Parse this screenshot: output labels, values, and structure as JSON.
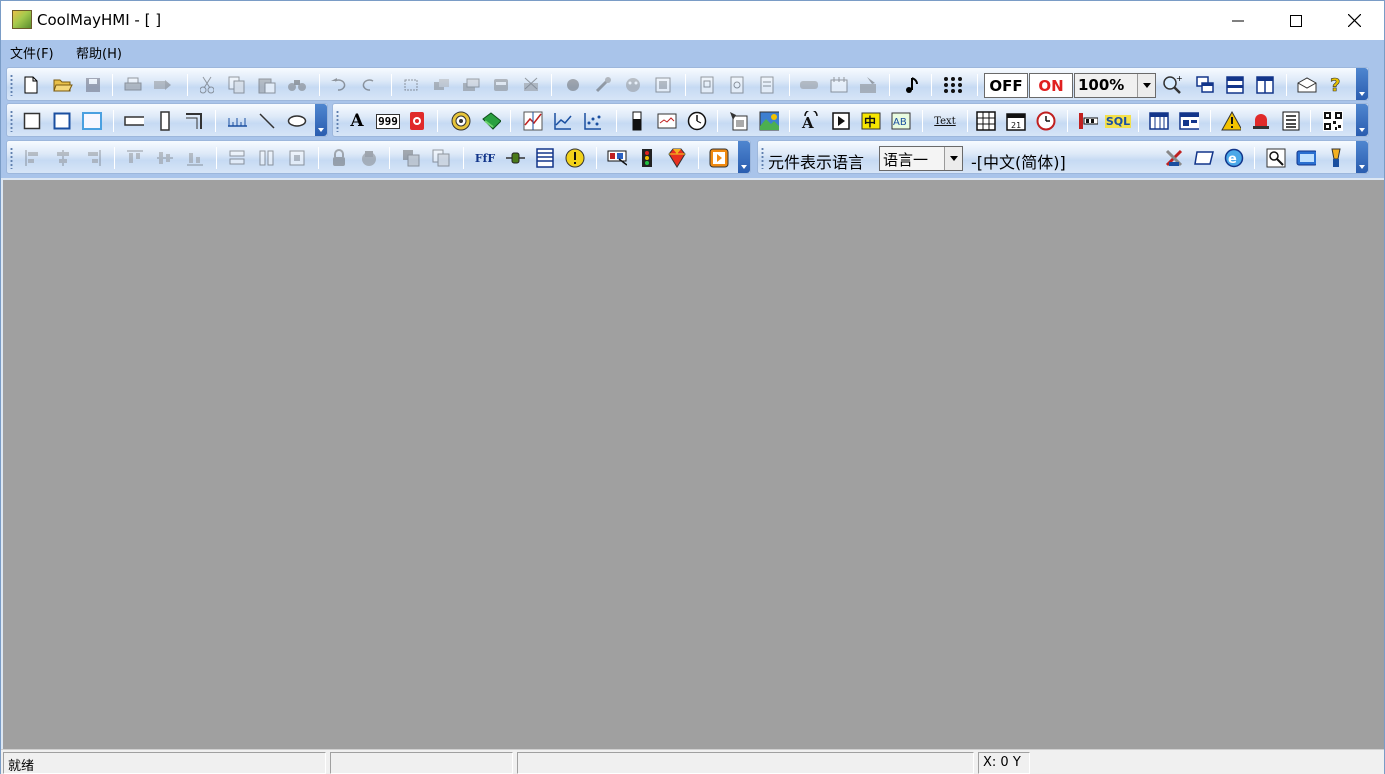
{
  "window": {
    "title": "CoolMayHMI - [ ]",
    "app_icon": "coolmay-hmi-logo-icon",
    "controls": [
      "minimize-icon",
      "maximize-icon",
      "close-icon"
    ]
  },
  "menu": [
    {
      "label": "文件(F)"
    },
    {
      "label": "帮助(H)"
    }
  ],
  "toolbar1": {
    "icons": [
      "new-file-icon",
      "open-folder-icon",
      "save-icon",
      "print-icon",
      "print-preview-icon",
      "cut-icon",
      "copy-icon",
      "paste-icon",
      "find-icon",
      "undo-icon",
      "redo-icon",
      "group-icon",
      "ungroup-icon",
      "bring-front-icon",
      "send-back-icon",
      "delete-icon",
      "compile-icon",
      "tools-icon",
      "simulate-icon",
      "download-icon",
      "screen-new-icon",
      "screen-copy-icon",
      "screen-delete-icon",
      "pointer-icon",
      "grid-icon",
      "bitmap-icon",
      "music-icon",
      "dots-grid-icon"
    ],
    "off_label": "OFF",
    "on_label": "ON",
    "zoom_value": "100%",
    "right_icons": [
      "zoom-in-icon",
      "window-cascade-icon",
      "window-tile-horizontal-icon",
      "window-tile-vertical-icon",
      "mail-icon",
      "help-icon"
    ]
  },
  "toolbar2": {
    "shapes_icons": [
      "rectangle-icon",
      "rounded-rectangle-icon",
      "fill-rectangle-icon",
      "horizontal-bar-icon",
      "vertical-bar-icon",
      "corner-line-icon",
      "scale-icon",
      "line-icon",
      "ellipse-icon"
    ],
    "parts_icons": [
      "text-icon",
      "number-display-icon",
      "alarm-lamp-icon",
      "knob-icon",
      "bit-switch-icon",
      "trend-graph-icon",
      "line-chart-icon",
      "xy-chart-icon",
      "bar-meter-icon",
      "slider-icon",
      "clock-gauge-icon",
      "function-icon",
      "picture-icon",
      "recipe-icon",
      "play-icon",
      "chinese-input-icon",
      "ascii-input-icon",
      "text-list-icon",
      "table-grid-icon",
      "calendar-icon",
      "timer-icon",
      "plc-icon",
      "sql-icon",
      "data-table-icon",
      "history-icon",
      "warning-icon",
      "alarm-bell-icon",
      "report-icon",
      "qr-code-icon"
    ],
    "text_icon_label": "A",
    "number_icon_label": "999",
    "sql_label": "SQL",
    "text_list_label": "Text"
  },
  "toolbar3": {
    "align_icons": [
      "align-left-icon",
      "align-center-icon",
      "align-right-icon",
      "align-top-icon",
      "align-middle-icon",
      "align-bottom-icon",
      "same-width-icon",
      "same-height-icon",
      "same-size-icon",
      "lock-icon",
      "unlock-icon",
      "layer-up-icon",
      "layer-down-icon"
    ],
    "misc_icons": [
      "font-icon",
      "indicator-icon",
      "film-icon",
      "alert-circle-icon",
      "monitor-icon",
      "traffic-light-icon",
      "gem-icon",
      "media-icon"
    ],
    "font_icon_label": "FfF",
    "language_label": "元件表示语言",
    "language_select": "语言一",
    "language_value": "-[中文(简体)]",
    "right_icons": [
      "tools-cross-icon",
      "window-icon",
      "browser-icon",
      "search-icon",
      "keyboard-icon",
      "brush-icon"
    ]
  },
  "statusbar": {
    "status": "就绪",
    "coords": "X: 0  Y"
  },
  "colors": {
    "dock": "#a9c4ea",
    "workspace": "#a0a0a0",
    "on_red": "#e02020"
  }
}
